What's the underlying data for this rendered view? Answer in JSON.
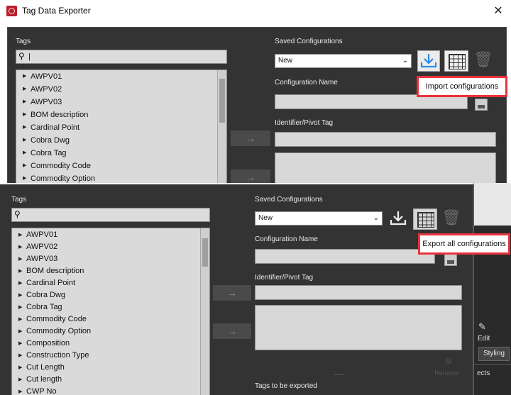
{
  "window": {
    "title": "Tag Data Exporter",
    "close_glyph": "✕"
  },
  "top": {
    "tags_label": "Tags",
    "search_value": "|",
    "tags": [
      "AWPV01",
      "AWPV02",
      "AWPV03",
      "BOM description",
      "Cardinal Point",
      "Cobra Dwg",
      "Cobra Tag",
      "Commodity Code",
      "Commodity Option"
    ],
    "saved_label": "Saved Configurations",
    "saved_value": "New",
    "config_name_label": "Configuration Name",
    "pivot_label": "Identifier/Pivot Tag",
    "tooltip": "Import configurations",
    "arrow": "→"
  },
  "bottom": {
    "tags_label": "Tags",
    "tags": [
      "AWPV01",
      "AWPV02",
      "AWPV03",
      "BOM description",
      "Cardinal Point",
      "Cobra Dwg",
      "Cobra Tag",
      "Commodity Code",
      "Commodity Option",
      "Composition",
      "Construction Type",
      "Cut Length",
      "Cut length",
      "CWP No"
    ],
    "saved_label": "Saved Configurations",
    "saved_value": "New",
    "config_name_label": "Configuration Name",
    "pivot_label": "Identifier/Pivot Tag",
    "tooltip": "Export all configurations",
    "remove_label": "Remove",
    "remove_glyph": "⊖",
    "export_label": "Tags to be exported",
    "arrow": "→"
  },
  "right_panel": {
    "edit_label": "Edit",
    "edit_glyph": "✎",
    "styling_label": "Styling",
    "objects_label": "ects"
  },
  "colors": {
    "highlight": "#e8323c",
    "panel": "#333333",
    "app_icon": "#b8202a"
  },
  "icons": {
    "download": "download-icon",
    "grid": "grid-icon",
    "trash": "trash-icon",
    "save": "save-icon",
    "search": "search-icon"
  }
}
